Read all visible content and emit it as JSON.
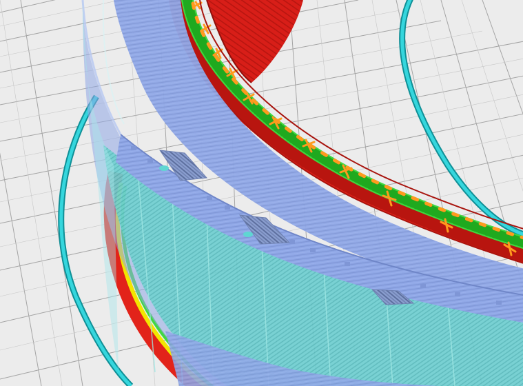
{
  "viewer": {
    "view": "gcode-layer-preview",
    "colors": {
      "build_plate": "#ececec",
      "grid_line": "#9a9a9a",
      "outer_wall": "#e2231a",
      "inner_wall": "#3fd83f",
      "skin": "#f2e600",
      "infill": "#ff9a1e",
      "support": "#78dcd8",
      "support_interface": "#8fa7e6",
      "travel": "#1ec8d2"
    },
    "feature_icons": [
      "outer-wall",
      "inner-wall",
      "skin",
      "infill",
      "support",
      "support-interface",
      "travel-move"
    ]
  }
}
